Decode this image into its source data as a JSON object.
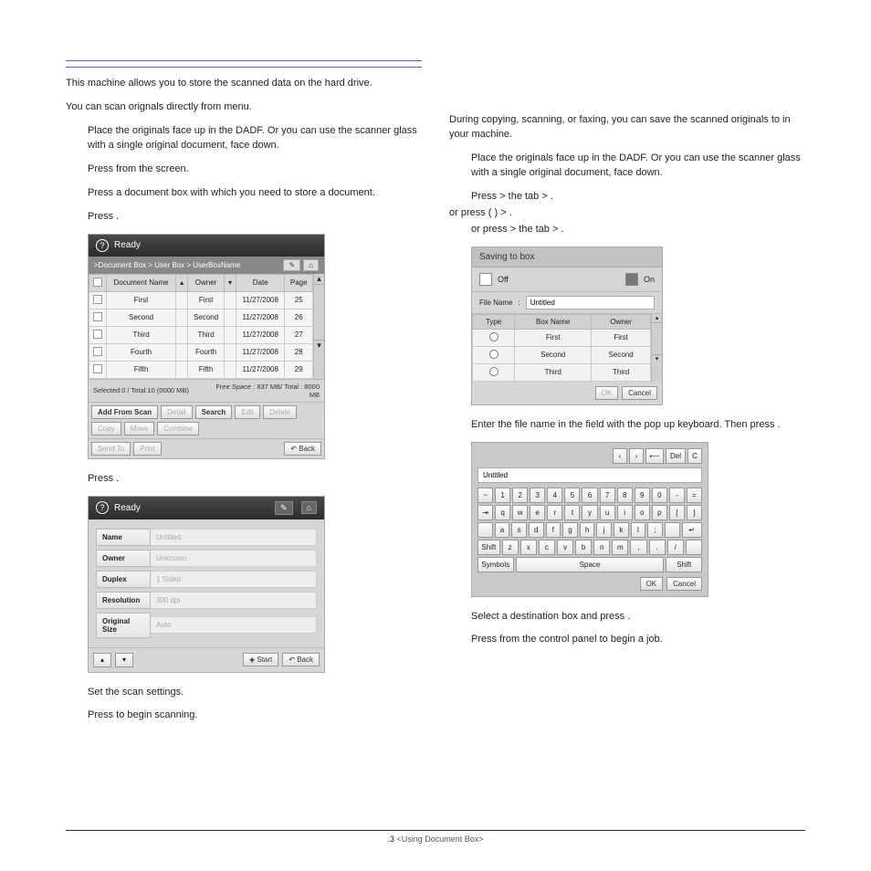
{
  "intro": "This machine allows you to store the scanned data on the hard drive.",
  "left": {
    "scan_line": "You can scan orignals directly from                                  menu.",
    "step_place": "Place the originals face up in the DADF. Or you can use the scanner glass with a single original document, face down.",
    "step_press_screen": "Press                          from the            screen.",
    "step_press_box": "Press a document box with which you need to store a document.",
    "step_press_only": "Press        .",
    "step_press_after": "Press                       .",
    "step_set": "Set the scan settings.",
    "step_begin": "Press           to begin scanning.",
    "panel1": {
      "title": "Ready",
      "breadcrumb": ">Document Box > User Box > UserBoxName",
      "cols": [
        "",
        "Document Name",
        "",
        "Owner",
        "",
        "Date",
        "Page"
      ],
      "rows": [
        [
          "",
          "First",
          "",
          "First",
          "",
          "11/27/2008",
          "25"
        ],
        [
          "",
          "Second",
          "",
          "Second",
          "",
          "11/27/2008",
          "26"
        ],
        [
          "",
          "Third",
          "",
          "Third",
          "",
          "11/27/2008",
          "27"
        ],
        [
          "",
          "Fourth",
          "",
          "Fourth",
          "",
          "11/27/2008",
          "28"
        ],
        [
          "",
          "Fifth",
          "",
          "Fifth",
          "",
          "11/27/2008",
          "29"
        ]
      ],
      "info_selected": "Selected:0 /  Total:10 (0000 MB)",
      "info_free": "Free Space : 837 MB/ Total : 8000 MB",
      "btns1": [
        "Add From Scan",
        "Detail",
        "Search",
        "Edit",
        "Delete",
        "Copy",
        "Move",
        "Combine"
      ],
      "btns2_left": [
        "Send To",
        "Print"
      ],
      "btn_back": "Back"
    },
    "panel2": {
      "title": "Ready",
      "rows": [
        {
          "lbl": "Name",
          "val": "Untitled"
        },
        {
          "lbl": "Owner",
          "val": "Unknown"
        },
        {
          "lbl": "Duplex",
          "val": "1 Sided"
        },
        {
          "lbl": "Resolution",
          "val": "300 dpi"
        },
        {
          "lbl": "Original Size",
          "val": "Auto"
        }
      ],
      "btn_start": "Start",
      "btn_back": "Back"
    }
  },
  "right": {
    "intro": "During copying, scanning, or faxing, you can save the scanned originals to                             in your machine.",
    "step_place": "Place the originals face up in the DADF. Or you can use the scanner glass with a single original document, face down.",
    "press_lines": [
      "Press            > the            tab >                       .",
      "or press                          (                         ) >                       .",
      "or press          > the            tab >                       ."
    ],
    "stb": {
      "title": "Saving to box",
      "off": "Off",
      "on": "On",
      "file_lbl": "File Name",
      "file_val": "Untitled",
      "cols": [
        "Type",
        "Box Name",
        "Owner"
      ],
      "rows": [
        [
          "",
          "First",
          "First"
        ],
        [
          "",
          "Second",
          "Second"
        ],
        [
          "",
          "Third",
          "Third"
        ]
      ],
      "ok": "OK",
      "cancel": "Cancel"
    },
    "step_filename": "Enter the file name in the                     field with the pop up keyboard. Then press        .",
    "keyboard": {
      "input": "Untitled",
      "top": [
        "‹",
        "›",
        "⟵",
        "Del",
        "C"
      ],
      "r1": [
        "~",
        "1",
        "2",
        "3",
        "4",
        "5",
        "6",
        "7",
        "8",
        "9",
        "0",
        "-",
        "="
      ],
      "r2": [
        "⇥",
        "q",
        "w",
        "e",
        "r",
        "t",
        "y",
        "u",
        "i",
        "o",
        "p",
        "[",
        "]"
      ],
      "r3": [
        "",
        "a",
        "s",
        "d",
        "f",
        "g",
        "h",
        "j",
        "k",
        "l",
        ";",
        "",
        "↵"
      ],
      "r4": [
        "Shift",
        "z",
        "x",
        "c",
        "v",
        "b",
        "n",
        "m",
        ",",
        ".",
        "/",
        ""
      ],
      "r5": [
        "Symbols",
        "Space",
        "Shift"
      ],
      "ok": "OK",
      "cancel": "Cancel"
    },
    "step_dest": "Select a destination box and press        .",
    "step_begin": "Press           from the control panel to begin a job."
  },
  "footer": {
    "page": ".3",
    "section": "<Using Document Box>"
  }
}
